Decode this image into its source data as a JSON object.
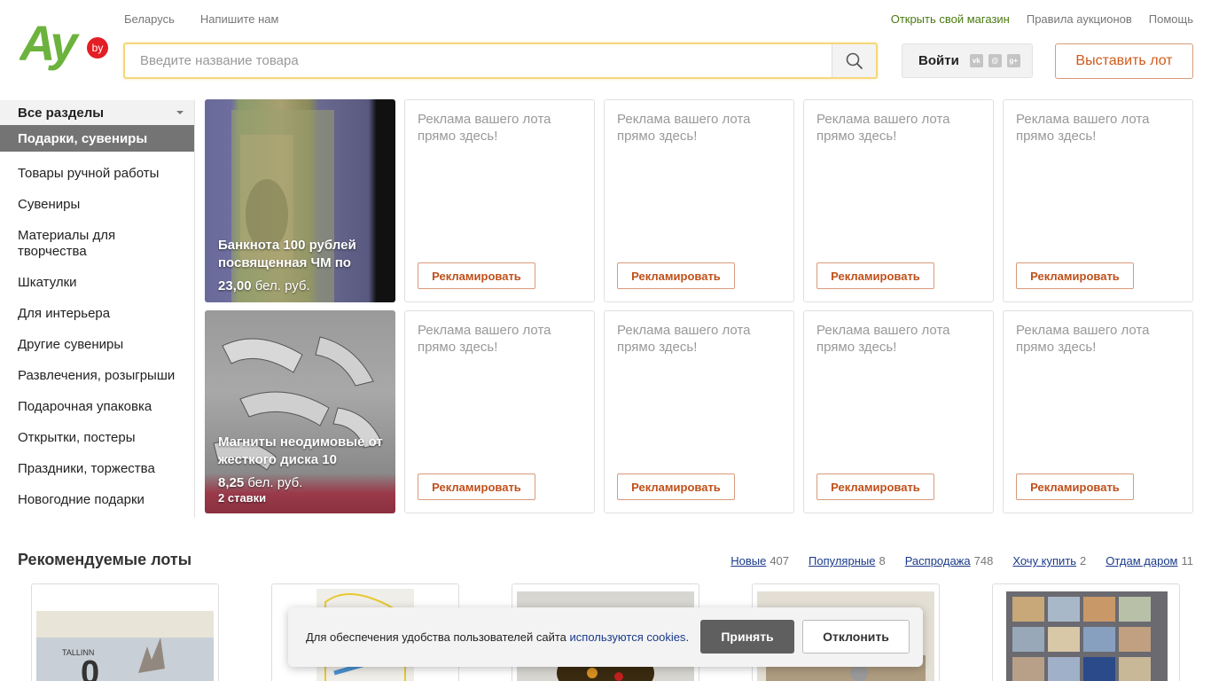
{
  "header": {
    "logo_text": "Ay",
    "logo_badge": "by",
    "links_left": [
      "Беларусь",
      "Напишите нам"
    ],
    "links_right": [
      "Открыть свой магазин",
      "Правила аукционов",
      "Помощь"
    ],
    "search_placeholder": "Введите название товара",
    "login_label": "Войти",
    "social_icons": [
      "vk-icon",
      "mail-icon",
      "google-plus-icon"
    ],
    "sell_label": "Выставить лот"
  },
  "sidebar": {
    "all_label": "Все разделы",
    "current": "Подарки, сувениры",
    "items": [
      "Товары ручной работы",
      "Сувениры",
      "Материалы для творчества",
      "Шкатулки",
      "Для интерьера",
      "Другие сувениры",
      "Развлечения, розыгрыши",
      "Подарочная упаковка",
      "Открытки, постеры",
      "Праздники, торжества",
      "Новогодние подарки"
    ]
  },
  "lots": [
    {
      "title": "Банкнота 100 рублей посвященная ЧМ по",
      "price": "23,00",
      "currency": "бел. руб.",
      "bids": ""
    },
    {
      "title": "Магниты неодимовые от жесткого диска 10",
      "price": "8,25",
      "currency": "бел. руб.",
      "bids": "2 ставки"
    }
  ],
  "ad": {
    "text": "Реклама вашего лота прямо здесь!",
    "button": "Рекламировать"
  },
  "recommended": {
    "title": "Рекомендуемые лоты",
    "tabs": [
      {
        "label": "Новые",
        "count": "407"
      },
      {
        "label": "Популярные",
        "count": "8"
      },
      {
        "label": "Распродажа",
        "count": "748"
      },
      {
        "label": "Хочу купить",
        "count": "2"
      },
      {
        "label": "Отдам даром",
        "count": "11"
      }
    ]
  },
  "cookie": {
    "text": "Для обеспечения удобства пользователей сайта",
    "link": "используются cookies",
    "suffix": ".",
    "accept": "Принять",
    "decline": "Отклонить"
  },
  "colors": {
    "logo_green": "#6cb33e",
    "badge_red": "#e31e24",
    "accent_orange": "#d05a1a",
    "link_blue": "#1a3a8a"
  }
}
